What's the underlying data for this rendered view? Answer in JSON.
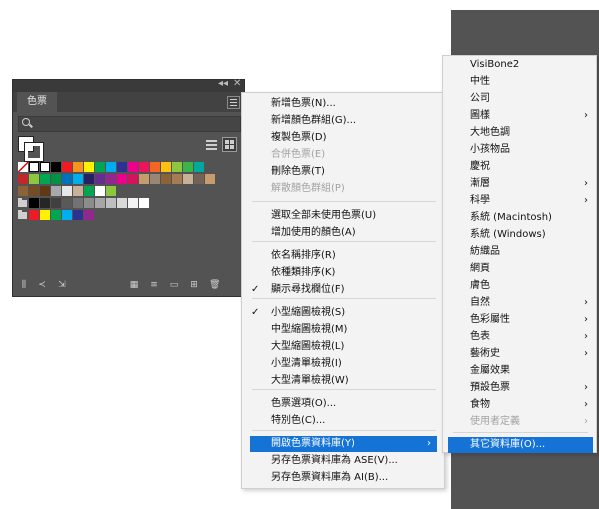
{
  "panel": {
    "tab_label": "色票",
    "collapse_glyph": "◂◂",
    "close_glyph": "✕",
    "swatch_rows": [
      [
        "#ffffff",
        "#ffffff",
        "#ffffff",
        "#000000",
        "#ed1c24",
        "#f7941d",
        "#fff200",
        "#00a651",
        "#00aeef",
        "#2e3192",
        "#ec008c",
        "#ed145b",
        "#f26522",
        "#ffc20e",
        "#8dc63f",
        "#39b54a",
        "#00a99d"
      ],
      [
        "#c1272d",
        "#8dc63f",
        "#00a651",
        "#009245",
        "#0072bc",
        "#00aeef",
        "#262262",
        "#662d91",
        "#92278f",
        "#ec008c",
        "#d4145a",
        "#c69c6d",
        "#998675",
        "#8c6239",
        "#a67c52",
        "#c7b299",
        "#736357",
        "#c69c6d"
      ],
      [
        "#8c6239",
        "#754c24",
        "#603813",
        "#a7a9ac",
        "#e6e7e8",
        "#c7b299",
        "#00a651",
        "#ffffff",
        "#8dc63f"
      ],
      [
        "#000000",
        "#262626",
        "#404040",
        "#595959",
        "#737373",
        "#8c8c8c",
        "#a6a6a6",
        "#bfbfbf",
        "#d9d9d9",
        "#f2f2f2",
        "#ffffff"
      ],
      [
        "#ed1c24",
        "#fff200",
        "#00a651",
        "#00aeef",
        "#2e3192",
        "#92278f"
      ]
    ],
    "icons": [
      "library-icon",
      "place-icon",
      "import-icon",
      "swatch-kind-icon",
      "swatch-options-icon",
      "new-folder-icon",
      "new-swatch-icon",
      "delete-icon"
    ]
  },
  "menu": {
    "items": [
      {
        "label": "新增色票(N)..."
      },
      {
        "label": "新增顏色群組(G)..."
      },
      {
        "label": "複製色票(D)"
      },
      {
        "label": "合併色票(E)",
        "disabled": true
      },
      {
        "label": "刪除色票(T)"
      },
      {
        "label": "解散顏色群組(P)",
        "disabled": true
      },
      {
        "label": "選取全部未使用色票(U)"
      },
      {
        "label": "增加使用的顏色(A)"
      },
      {
        "label": "依名稱排序(R)"
      },
      {
        "label": "依種類排序(K)"
      },
      {
        "label": "顯示尋找欄位(F)",
        "checked": true
      },
      {
        "label": "小型縮圖檢視(S)",
        "checked": true
      },
      {
        "label": "中型縮圖檢視(M)"
      },
      {
        "label": "大型縮圖檢視(L)"
      },
      {
        "label": "小型清單檢視(I)"
      },
      {
        "label": "大型清單檢視(W)"
      },
      {
        "label": "色票選項(O)..."
      },
      {
        "label": "特別色(C)..."
      },
      {
        "label": "開啟色票資料庫(Y)",
        "submenu": true,
        "highlight": true
      },
      {
        "label": "另存色票資料庫為 ASE(V)..."
      },
      {
        "label": "另存色票資料庫為 AI(B)..."
      }
    ],
    "check_glyph": "✓",
    "arrow_glyph": "›"
  },
  "submenu": {
    "items": [
      {
        "label": "VisiBone2"
      },
      {
        "label": "中性"
      },
      {
        "label": "公司"
      },
      {
        "label": "圖樣",
        "submenu": true
      },
      {
        "label": "大地色調"
      },
      {
        "label": "小孩物品"
      },
      {
        "label": "慶祝"
      },
      {
        "label": "漸層",
        "submenu": true
      },
      {
        "label": "科學",
        "submenu": true
      },
      {
        "label": "系統 (Macintosh)"
      },
      {
        "label": "系統 (Windows)"
      },
      {
        "label": "紡織品"
      },
      {
        "label": "網頁"
      },
      {
        "label": "膚色"
      },
      {
        "label": "自然",
        "submenu": true
      },
      {
        "label": "色彩屬性",
        "submenu": true
      },
      {
        "label": "色表",
        "submenu": true
      },
      {
        "label": "藝術史",
        "submenu": true
      },
      {
        "label": "金屬效果"
      },
      {
        "label": "預設色票",
        "submenu": true
      },
      {
        "label": "食物",
        "submenu": true
      },
      {
        "label": "使用者定義",
        "submenu": true,
        "disabled": true
      },
      {
        "label": "其它資料庫(O)...",
        "highlight": true
      }
    ]
  }
}
